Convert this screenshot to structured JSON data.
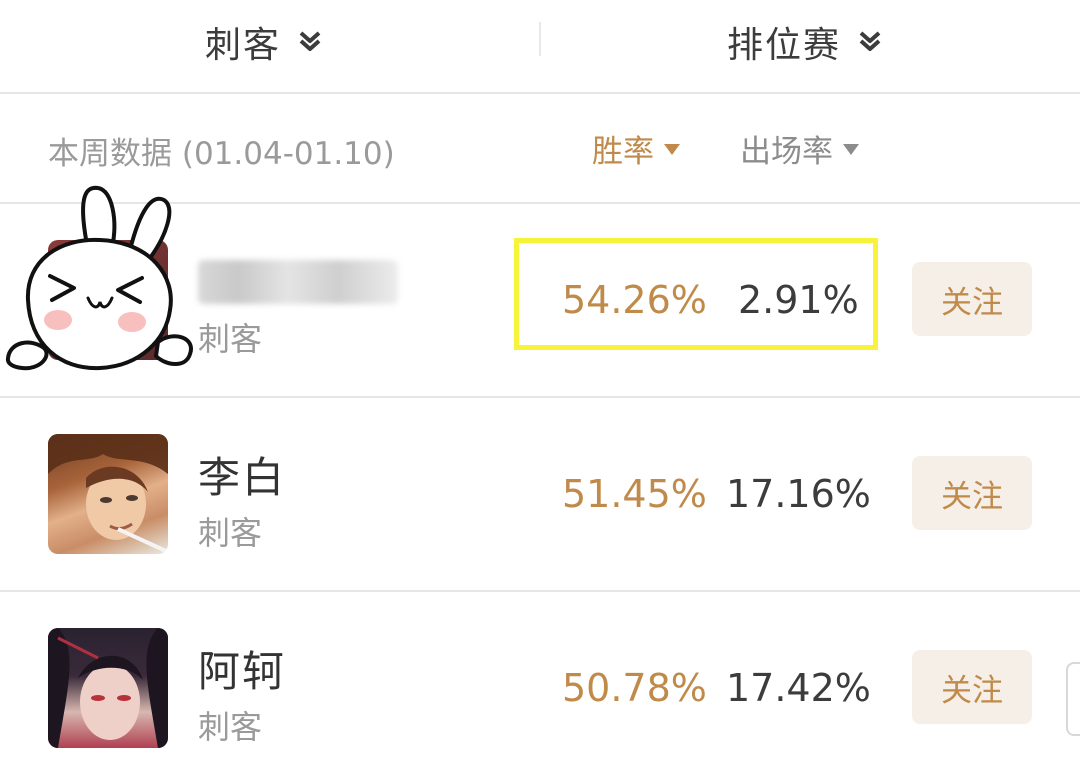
{
  "filters": {
    "role": {
      "label": "刺客",
      "icon": "chevron-double-down-icon"
    },
    "mode": {
      "label": "排位赛",
      "icon": "chevron-double-down-icon"
    }
  },
  "stats_header": {
    "week_label": "本周数据 (01.04-01.10)",
    "sort_win": "胜率",
    "sort_pick": "出场率",
    "active_sort": "胜率"
  },
  "heroes": [
    {
      "name": "",
      "role": "刺客",
      "win_rate": "54.26%",
      "pick_rate": "2.91%",
      "follow_label": "关注",
      "avatar": "bunny-sticker-covered"
    },
    {
      "name": "李白",
      "role": "刺客",
      "win_rate": "51.45%",
      "pick_rate": "17.16%",
      "follow_label": "关注",
      "avatar": "libai-portrait"
    },
    {
      "name": "阿轲",
      "role": "刺客",
      "win_rate": "50.78%",
      "pick_rate": "17.42%",
      "follow_label": "关注",
      "avatar": "ake-portrait"
    }
  ],
  "colors": {
    "accent": "#c08a4a",
    "follow_bg": "#f6efe8",
    "highlight": "#f7f23a",
    "divider": "#e6e6e6"
  }
}
